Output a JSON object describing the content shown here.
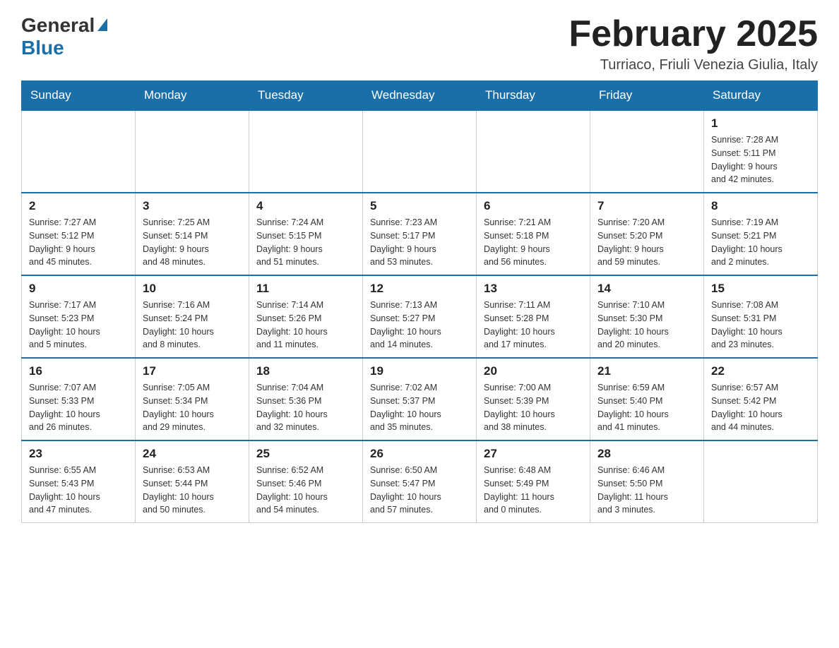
{
  "header": {
    "logo_general": "General",
    "logo_blue": "Blue",
    "title": "February 2025",
    "subtitle": "Turriaco, Friuli Venezia Giulia, Italy"
  },
  "days_of_week": [
    "Sunday",
    "Monday",
    "Tuesday",
    "Wednesday",
    "Thursday",
    "Friday",
    "Saturday"
  ],
  "weeks": [
    {
      "days": [
        {
          "date": "",
          "info": ""
        },
        {
          "date": "",
          "info": ""
        },
        {
          "date": "",
          "info": ""
        },
        {
          "date": "",
          "info": ""
        },
        {
          "date": "",
          "info": ""
        },
        {
          "date": "",
          "info": ""
        },
        {
          "date": "1",
          "info": "Sunrise: 7:28 AM\nSunset: 5:11 PM\nDaylight: 9 hours\nand 42 minutes."
        }
      ]
    },
    {
      "days": [
        {
          "date": "2",
          "info": "Sunrise: 7:27 AM\nSunset: 5:12 PM\nDaylight: 9 hours\nand 45 minutes."
        },
        {
          "date": "3",
          "info": "Sunrise: 7:25 AM\nSunset: 5:14 PM\nDaylight: 9 hours\nand 48 minutes."
        },
        {
          "date": "4",
          "info": "Sunrise: 7:24 AM\nSunset: 5:15 PM\nDaylight: 9 hours\nand 51 minutes."
        },
        {
          "date": "5",
          "info": "Sunrise: 7:23 AM\nSunset: 5:17 PM\nDaylight: 9 hours\nand 53 minutes."
        },
        {
          "date": "6",
          "info": "Sunrise: 7:21 AM\nSunset: 5:18 PM\nDaylight: 9 hours\nand 56 minutes."
        },
        {
          "date": "7",
          "info": "Sunrise: 7:20 AM\nSunset: 5:20 PM\nDaylight: 9 hours\nand 59 minutes."
        },
        {
          "date": "8",
          "info": "Sunrise: 7:19 AM\nSunset: 5:21 PM\nDaylight: 10 hours\nand 2 minutes."
        }
      ]
    },
    {
      "days": [
        {
          "date": "9",
          "info": "Sunrise: 7:17 AM\nSunset: 5:23 PM\nDaylight: 10 hours\nand 5 minutes."
        },
        {
          "date": "10",
          "info": "Sunrise: 7:16 AM\nSunset: 5:24 PM\nDaylight: 10 hours\nand 8 minutes."
        },
        {
          "date": "11",
          "info": "Sunrise: 7:14 AM\nSunset: 5:26 PM\nDaylight: 10 hours\nand 11 minutes."
        },
        {
          "date": "12",
          "info": "Sunrise: 7:13 AM\nSunset: 5:27 PM\nDaylight: 10 hours\nand 14 minutes."
        },
        {
          "date": "13",
          "info": "Sunrise: 7:11 AM\nSunset: 5:28 PM\nDaylight: 10 hours\nand 17 minutes."
        },
        {
          "date": "14",
          "info": "Sunrise: 7:10 AM\nSunset: 5:30 PM\nDaylight: 10 hours\nand 20 minutes."
        },
        {
          "date": "15",
          "info": "Sunrise: 7:08 AM\nSunset: 5:31 PM\nDaylight: 10 hours\nand 23 minutes."
        }
      ]
    },
    {
      "days": [
        {
          "date": "16",
          "info": "Sunrise: 7:07 AM\nSunset: 5:33 PM\nDaylight: 10 hours\nand 26 minutes."
        },
        {
          "date": "17",
          "info": "Sunrise: 7:05 AM\nSunset: 5:34 PM\nDaylight: 10 hours\nand 29 minutes."
        },
        {
          "date": "18",
          "info": "Sunrise: 7:04 AM\nSunset: 5:36 PM\nDaylight: 10 hours\nand 32 minutes."
        },
        {
          "date": "19",
          "info": "Sunrise: 7:02 AM\nSunset: 5:37 PM\nDaylight: 10 hours\nand 35 minutes."
        },
        {
          "date": "20",
          "info": "Sunrise: 7:00 AM\nSunset: 5:39 PM\nDaylight: 10 hours\nand 38 minutes."
        },
        {
          "date": "21",
          "info": "Sunrise: 6:59 AM\nSunset: 5:40 PM\nDaylight: 10 hours\nand 41 minutes."
        },
        {
          "date": "22",
          "info": "Sunrise: 6:57 AM\nSunset: 5:42 PM\nDaylight: 10 hours\nand 44 minutes."
        }
      ]
    },
    {
      "days": [
        {
          "date": "23",
          "info": "Sunrise: 6:55 AM\nSunset: 5:43 PM\nDaylight: 10 hours\nand 47 minutes."
        },
        {
          "date": "24",
          "info": "Sunrise: 6:53 AM\nSunset: 5:44 PM\nDaylight: 10 hours\nand 50 minutes."
        },
        {
          "date": "25",
          "info": "Sunrise: 6:52 AM\nSunset: 5:46 PM\nDaylight: 10 hours\nand 54 minutes."
        },
        {
          "date": "26",
          "info": "Sunrise: 6:50 AM\nSunset: 5:47 PM\nDaylight: 10 hours\nand 57 minutes."
        },
        {
          "date": "27",
          "info": "Sunrise: 6:48 AM\nSunset: 5:49 PM\nDaylight: 11 hours\nand 0 minutes."
        },
        {
          "date": "28",
          "info": "Sunrise: 6:46 AM\nSunset: 5:50 PM\nDaylight: 11 hours\nand 3 minutes."
        },
        {
          "date": "",
          "info": ""
        }
      ]
    }
  ]
}
